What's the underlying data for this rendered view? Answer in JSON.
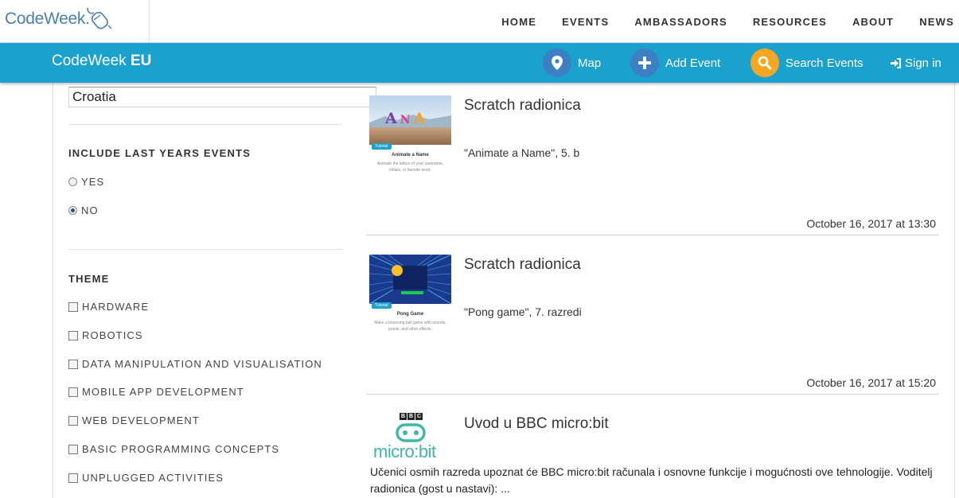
{
  "header": {
    "logo_text": "CodeWeek.",
    "nav": [
      "HOME",
      "EVENTS",
      "AMBASSADORS",
      "RESOURCES",
      "ABOUT",
      "NEWS"
    ]
  },
  "bar": {
    "brand_light": "CodeWeek",
    "brand_bold": "EU",
    "map_label": "Map",
    "add_label": "Add Event",
    "search_label": "Search Events",
    "signin_label": "Sign in"
  },
  "filters": {
    "country_value": "Croatia",
    "last_years_title": "INCLUDE LAST YEARS EVENTS",
    "yes_label": "YES",
    "no_label": "NO",
    "selected": "NO",
    "theme_title": "THEME",
    "themes": [
      "HARDWARE",
      "ROBOTICS",
      "DATA MANIPULATION AND VISUALISATION",
      "MOBILE APP DEVELOPMENT",
      "WEB DEVELOPMENT",
      "BASIC PROGRAMMING CONCEPTS",
      "UNPLUGGED ACTIVITIES"
    ]
  },
  "events": [
    {
      "title": "Scratch radionica",
      "description": "\"Animate a Name\", 5. b",
      "date": "October 16, 2017 at 13:30",
      "thumb_badge": "Tutorial",
      "thumb_name": "Animate a Name",
      "thumb_sub": "Animate the letters of your username, initials, or favorite word.",
      "thumb_letters": "A N A"
    },
    {
      "title": "Scratch radionica",
      "description": "\"Pong game\", 7. razredi",
      "date": "October 16, 2017 at 15:20",
      "thumb_badge": "Tutorial",
      "thumb_name": "Pong Game",
      "thumb_sub": "Make a bouncing ball game with sounds, points, and other effects."
    },
    {
      "title": "Uvod u BBC micro:bit",
      "description": "Učenici osmih razreda upoznat će BBC micro:bit računala i osnovne funkcije i mogućnosti ove tehnologije. Voditelj radionica (gost u nastavi): ...",
      "thumb_bbc": "BBC",
      "thumb_brand": "micro:bit"
    }
  ],
  "colors": {
    "bar": "#1ba1cd",
    "map_circle": "#3b7fc4",
    "search_circle": "#f5a623"
  }
}
